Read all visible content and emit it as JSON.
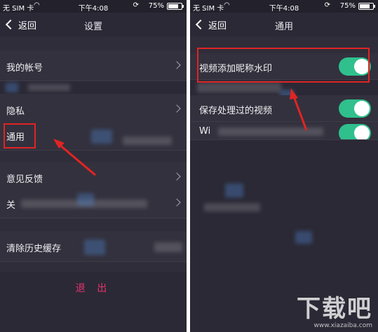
{
  "left": {
    "status": {
      "carrier": "无 SIM 卡",
      "time": "下午4:08",
      "battery": "75%",
      "battery_level": 0.75
    },
    "nav": {
      "back": "返回",
      "title": "设置"
    },
    "items": [
      {
        "label": "我的帐号"
      },
      {
        "label": "隐私"
      },
      {
        "label": "通用"
      },
      {
        "label": "意见反馈"
      },
      {
        "label": "关"
      },
      {
        "label": "清除历史缓存"
      }
    ],
    "logout": "退 出"
  },
  "right": {
    "status": {
      "carrier": "无 SIM 卡",
      "time": "下午4:08",
      "battery": "75%",
      "battery_level": 0.75
    },
    "nav": {
      "back": "返回",
      "title": "通用"
    },
    "toggles": [
      {
        "label": "视频添加昵称水印",
        "on": true
      },
      {
        "label": "保存处理过的视频",
        "on": true
      },
      {
        "label": "Wi",
        "on": true
      }
    ]
  },
  "watermark": {
    "main": "下载吧",
    "sub": "www.xiazaiba.com"
  },
  "colors": {
    "accent_green": "#2fc08d",
    "logout_pink": "#e8336f",
    "annotation_red": "#e12424"
  }
}
